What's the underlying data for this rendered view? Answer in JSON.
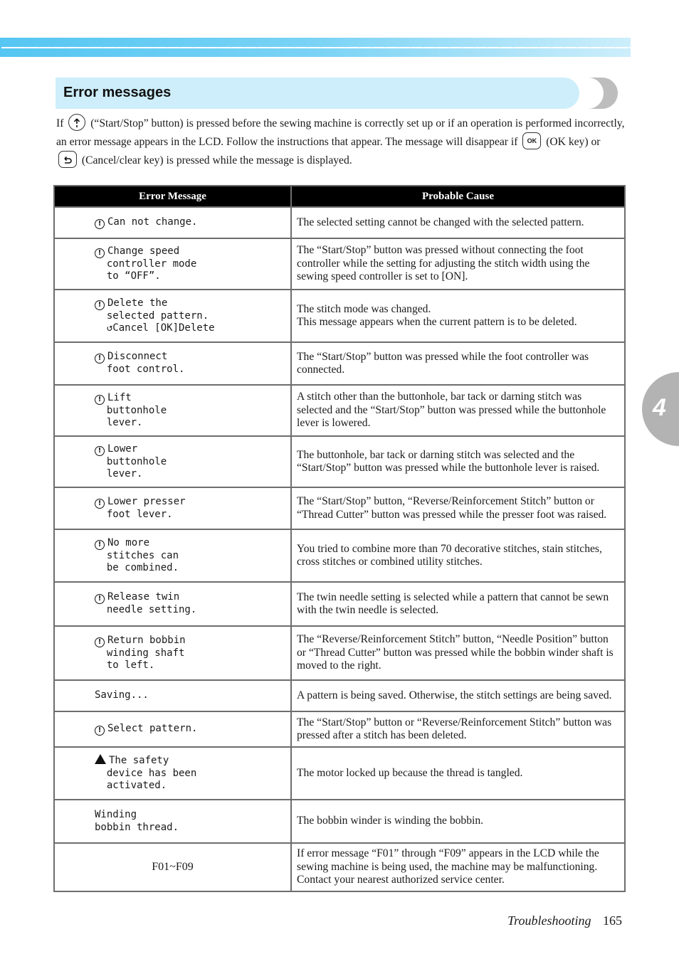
{
  "header": {
    "section_title": "Error messages"
  },
  "intro": {
    "part1": "If",
    "start_stop_key_icon": "start-stop-icon",
    "part2": "(“Start/Stop” button) is pressed before the sewing machine is correctly set up or if an operation is performed incorrectly, an error message appears in the LCD. Follow the instructions that appear. The message will disappear if",
    "ok_key_label": "OK",
    "part3": "(OK key) or",
    "cancel_key_icon": "cancel-clear-icon",
    "part4": "(Cancel/clear key)  is pressed while the message is displayed."
  },
  "table": {
    "headers": [
      "Error Message",
      "Probable Cause"
    ],
    "rows": [
      {
        "icon": "info",
        "message": "Can not change.",
        "cause": "The selected setting cannot be changed with the selected pattern."
      },
      {
        "icon": "info",
        "message": "Change speed\ncontroller mode\nto “OFF”.",
        "cause": "The “Start/Stop” button was pressed without connecting the foot controller while the setting for adjusting the stitch width using the sewing speed controller is set to [ON]."
      },
      {
        "icon": "info",
        "message": "Delete the\nselected pattern.\n↺Cancel [OK]Delete",
        "cause": "The stitch mode was changed.\nThis message appears when the current pattern is to be deleted."
      },
      {
        "icon": "info",
        "message": "Disconnect\nfoot control.",
        "cause": "The “Start/Stop” button was pressed while the foot controller was connected."
      },
      {
        "icon": "info",
        "message": "Lift\nbuttonhole\nlever.",
        "cause": "A stitch other than the buttonhole, bar tack or darning stitch was selected and the “Start/Stop” button was pressed while the buttonhole lever is lowered."
      },
      {
        "icon": "info",
        "message": "Lower\nbuttonhole\nlever.",
        "cause": "The buttonhole, bar tack or darning stitch was selected and the “Start/Stop” button was pressed while the buttonhole lever is raised."
      },
      {
        "icon": "info",
        "message": "Lower presser\nfoot lever.",
        "cause": "The “Start/Stop” button, “Reverse/Reinforcement Stitch” button or “Thread Cutter” button was pressed while the presser foot was raised."
      },
      {
        "icon": "info",
        "message": "No more\nstitches can\nbe combined.",
        "cause": "You tried to combine more than 70 decorative stitches, stain stitches, cross stitches or combined utility stitches."
      },
      {
        "icon": "info",
        "message": "Release twin\nneedle setting.",
        "cause": "The twin needle setting is selected while a pattern that cannot be sewn with the twin needle is selected."
      },
      {
        "icon": "info",
        "message": "Return bobbin\nwinding shaft\nto left.",
        "cause": "The “Reverse/Reinforcement Stitch” button, “Needle Position” button or “Thread Cutter” button was pressed while the bobbin winder shaft is moved to the right."
      },
      {
        "icon": "none",
        "message": "Saving...",
        "cause": "A pattern is being saved. Otherwise, the stitch settings are being saved."
      },
      {
        "icon": "info",
        "message": "Select pattern.",
        "cause": "The “Start/Stop” button or “Reverse/Reinforcement Stitch” button was pressed after a stitch has been deleted."
      },
      {
        "icon": "warning",
        "message": "The safety\ndevice has been\nactivated.",
        "cause": "The motor locked up because the thread is tangled."
      },
      {
        "icon": "none",
        "message": "Winding\nbobbin thread.",
        "cause": "The bobbin winder is winding the bobbin."
      },
      {
        "icon": "plain",
        "message": "F01~F09",
        "cause": "If error message “F01” through “F09” appears in the LCD while the sewing machine is being used, the machine may be malfunctioning. Contact your nearest authorized service center."
      }
    ]
  },
  "chapter_tab": {
    "number": "4"
  },
  "footer": {
    "section": "Troubleshooting",
    "page": "165"
  },
  "colors": {
    "band_start": "#55c6f2",
    "band_end": "#cdeefb",
    "header_pill": "#cdeefa",
    "tab_gray": "#b3b3b3"
  }
}
